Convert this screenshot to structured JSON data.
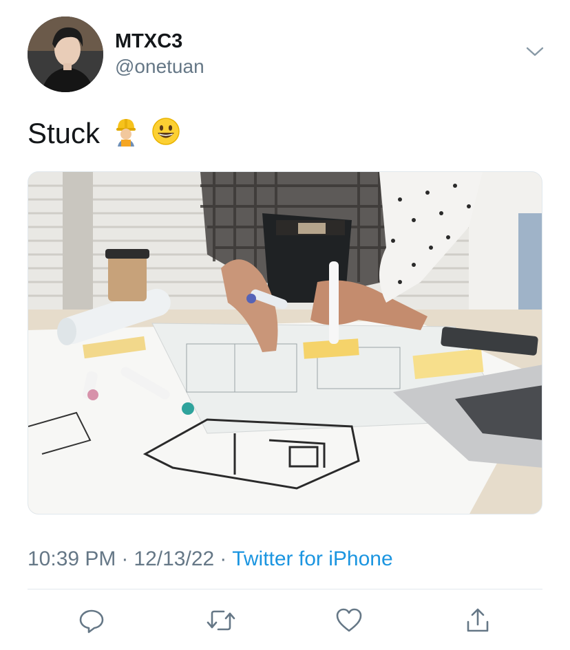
{
  "author": {
    "display_name": "MTXC3",
    "handle": "@onetuan"
  },
  "tweet": {
    "text": "Stuck",
    "emojis": [
      "construction-worker-emoji",
      "grinning-face-emoji"
    ]
  },
  "media": {
    "type": "photo",
    "subject": "architects-drawing-floor-plans"
  },
  "meta": {
    "time": "10:39 PM",
    "separator": "·",
    "date": "12/13/22",
    "source": "Twitter for iPhone"
  },
  "actions": [
    {
      "icon": "reply-icon"
    },
    {
      "icon": "retweet-icon"
    },
    {
      "icon": "like-icon"
    },
    {
      "icon": "share-icon"
    }
  ],
  "colors": {
    "text_primary": "#14171a",
    "text_secondary": "#657786",
    "link": "#1b95e0",
    "divider": "#e1e8ed"
  }
}
